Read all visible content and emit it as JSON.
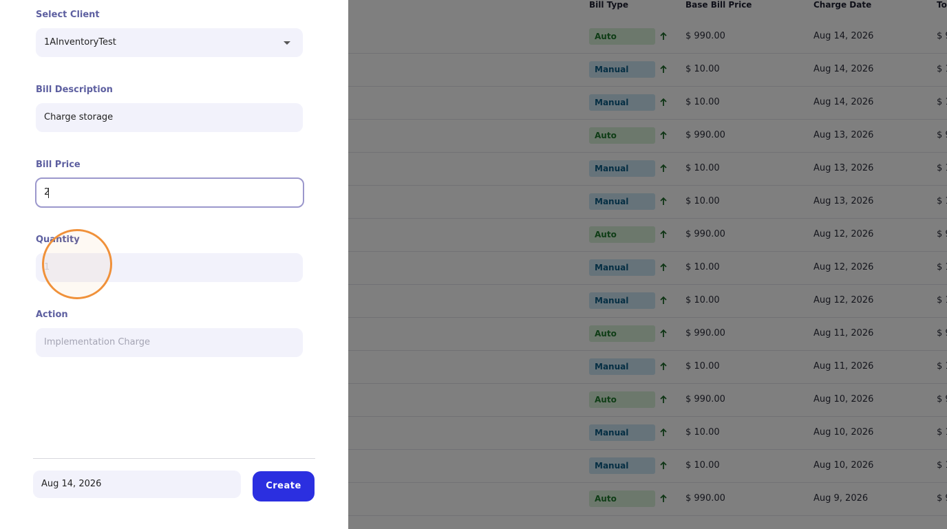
{
  "table": {
    "columns": [
      "Bill Type",
      "Base Bill Price",
      "Charge Date",
      "To"
    ],
    "rows": [
      {
        "bill_type": "Auto",
        "price": "$ 990.00",
        "date": "Aug 14, 2026",
        "total": "$ 9"
      },
      {
        "bill_type": "Manual",
        "price": "$ 10.00",
        "date": "Aug 14, 2026",
        "total": "$ 1"
      },
      {
        "bill_type": "Manual",
        "price": "$ 10.00",
        "date": "Aug 14, 2026",
        "total": "$ 1"
      },
      {
        "bill_type": "Auto",
        "price": "$ 990.00",
        "date": "Aug 13, 2026",
        "total": "$ 9"
      },
      {
        "bill_type": "Manual",
        "price": "$ 10.00",
        "date": "Aug 13, 2026",
        "total": "$ 1"
      },
      {
        "bill_type": "Manual",
        "price": "$ 10.00",
        "date": "Aug 13, 2026",
        "total": "$ 1"
      },
      {
        "bill_type": "Auto",
        "price": "$ 990.00",
        "date": "Aug 12, 2026",
        "total": "$ 9"
      },
      {
        "bill_type": "Manual",
        "price": "$ 10.00",
        "date": "Aug 12, 2026",
        "total": "$ 1"
      },
      {
        "bill_type": "Manual",
        "price": "$ 10.00",
        "date": "Aug 12, 2026",
        "total": "$ 1"
      },
      {
        "bill_type": "Auto",
        "price": "$ 990.00",
        "date": "Aug 11, 2026",
        "total": "$ 9"
      },
      {
        "bill_type": "Manual",
        "price": "$ 10.00",
        "date": "Aug 11, 2026",
        "total": "$ 1"
      },
      {
        "bill_type": "Auto",
        "price": "$ 990.00",
        "date": "Aug 10, 2026",
        "total": "$ 9"
      },
      {
        "bill_type": "Manual",
        "price": "$ 10.00",
        "date": "Aug 10, 2026",
        "total": "$ 1"
      },
      {
        "bill_type": "Manual",
        "price": "$ 10.00",
        "date": "Aug 10, 2026",
        "total": "$ 1"
      },
      {
        "bill_type": "Auto",
        "price": "$ 990.00",
        "date": "Aug 9, 2026",
        "total": "$ 9"
      }
    ]
  },
  "drawer": {
    "client_label": "Select Client",
    "client_value": "1AInventoryTest",
    "description_label": "Bill Description",
    "description_value": "Charge storage",
    "price_label": "Bill Price",
    "price_value": "2",
    "quantity_label": "Quantity",
    "quantity_value": "1",
    "action_label": "Action",
    "action_placeholder": "Implementation Charge",
    "date_value": "Aug 14, 2026",
    "create_label": "Create"
  },
  "colors": {
    "accent": "#2b2fe0",
    "label": "#5d5fa0",
    "auto_badge": "#d8f0d9",
    "manual_badge": "#cde7f5",
    "click_ring": "#f0913a"
  },
  "icons": {
    "sort_arrow": "arrow-up-icon",
    "select_caret": "chevron-down-icon"
  }
}
